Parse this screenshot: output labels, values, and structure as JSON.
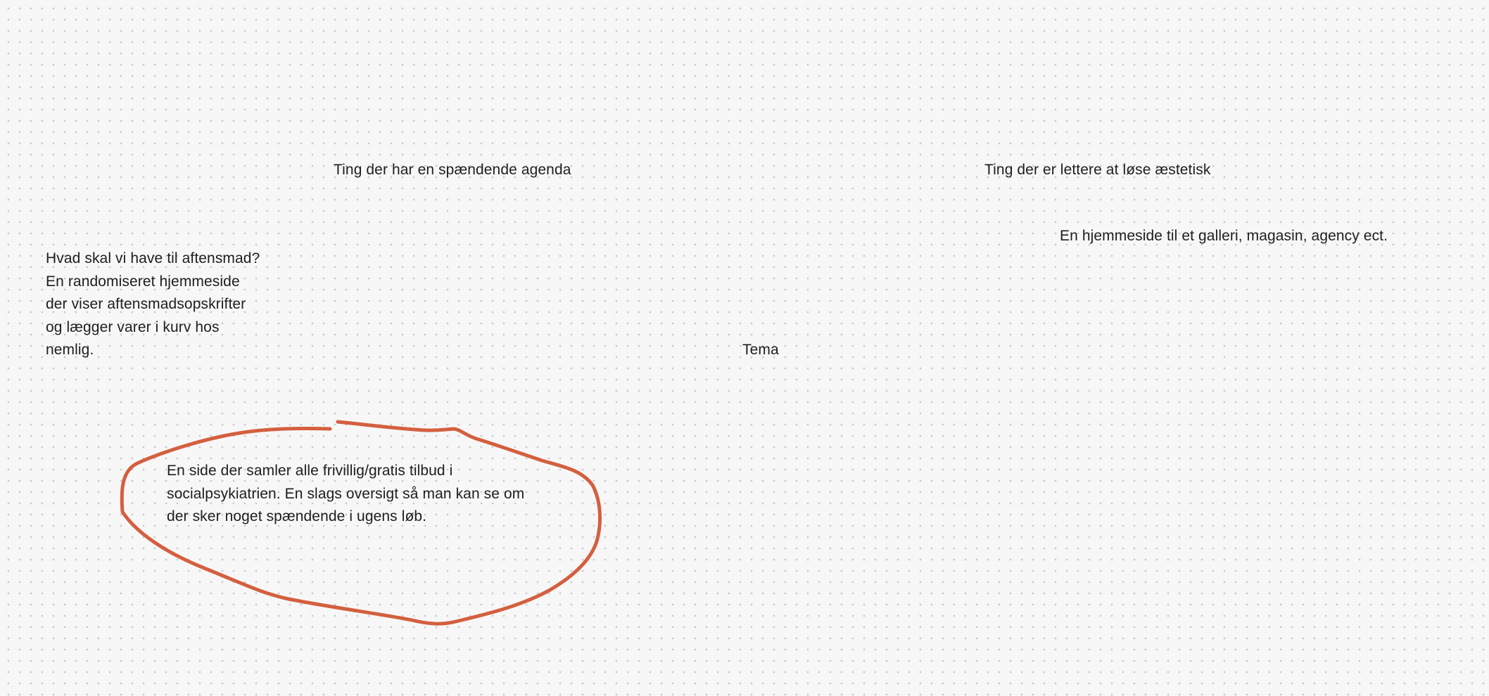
{
  "canvas": {
    "notes": {
      "heading_agenda": "Ting der har en spændende agenda",
      "heading_aesthetic": "Ting der er lettere at løse æstetisk",
      "gallery_idea": "En hjemmeside til et galleri, magasin, agency ect.",
      "dinner_idea": {
        "lines": [
          "Hvad skal vi have til aftensmad?",
          "En randomiseret hjemmeside",
          "der viser aftensmadsopskrifter",
          "og lægger varer i kurv hos",
          "nemlig."
        ]
      },
      "tema": "Tema",
      "volunteer_idea": {
        "lines": [
          "En side der samler alle frivillig/gratis tilbud i",
          "socialpsykiatrien. En slags oversigt så man kan se om",
          "der sker noget spændende i ugens løb."
        ]
      }
    },
    "drawing": {
      "stroke_color": "#d45f3f",
      "shape": "freehand-circle"
    },
    "colors": {
      "background": "#f7f7f7",
      "grid_dot": "#c9c9c9",
      "text": "#1e1e1e"
    }
  }
}
